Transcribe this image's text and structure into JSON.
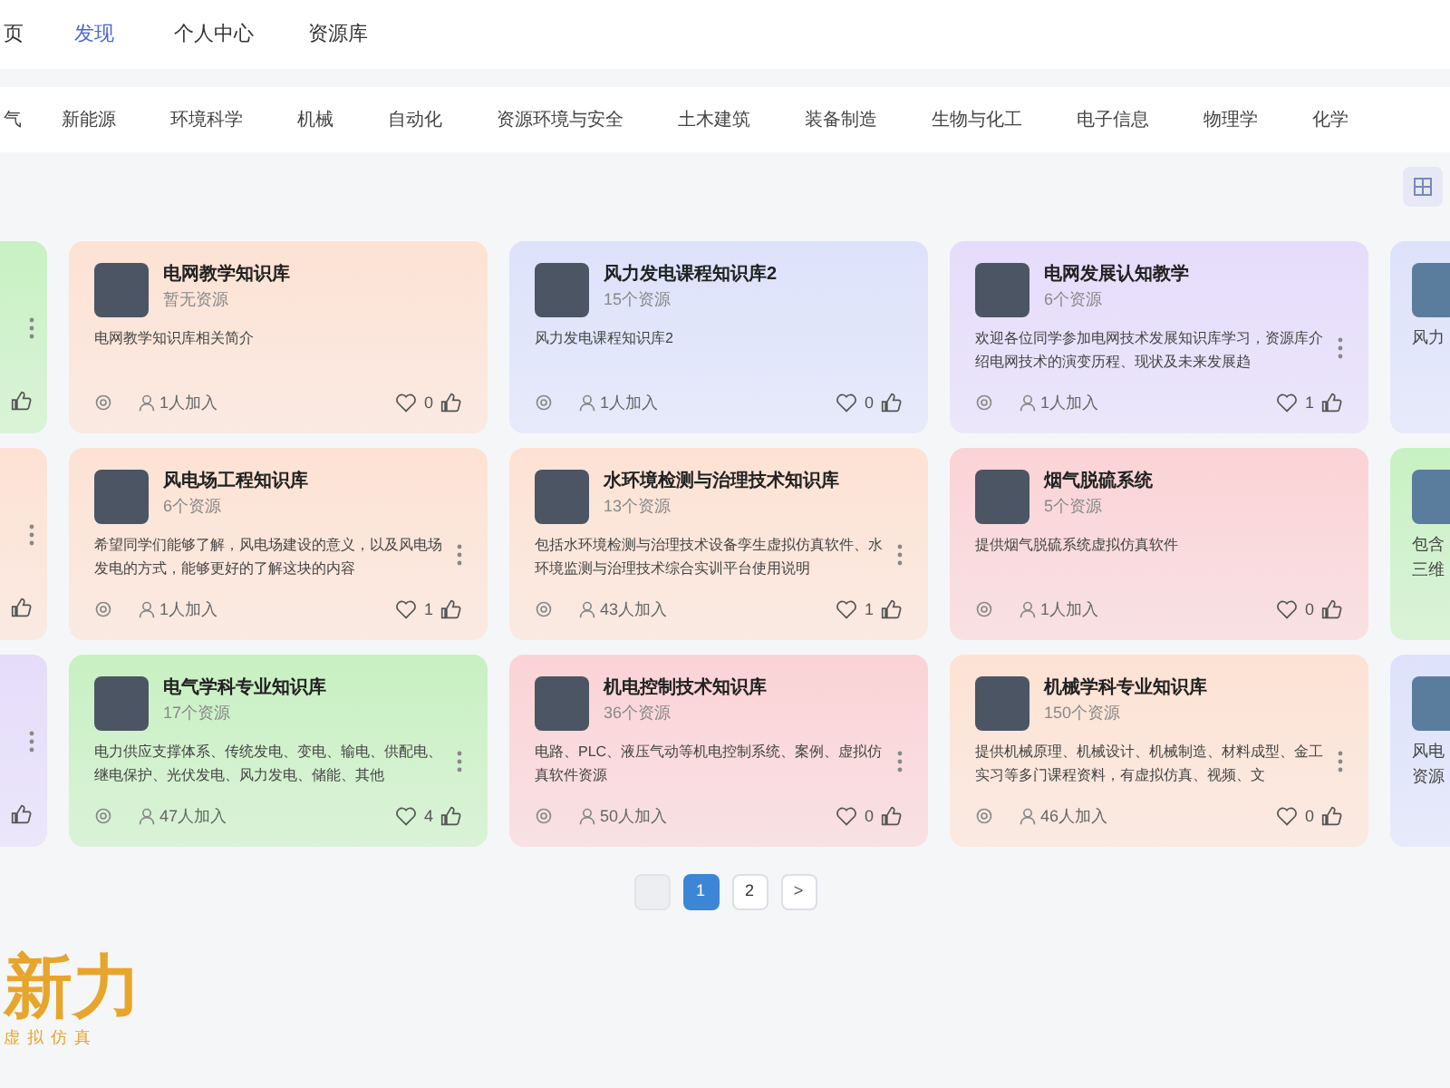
{
  "nav": {
    "items": [
      {
        "label": "页",
        "selected": false
      },
      {
        "label": "发现",
        "selected": true
      },
      {
        "label": "个人中心",
        "selected": false
      },
      {
        "label": "资源库",
        "selected": false
      }
    ]
  },
  "categories": [
    {
      "label": "气"
    },
    {
      "label": "新能源"
    },
    {
      "label": "环境科学"
    },
    {
      "label": "机械"
    },
    {
      "label": "自动化"
    },
    {
      "label": "资源环境与安全"
    },
    {
      "label": "土木建筑"
    },
    {
      "label": "装备制造"
    },
    {
      "label": "生物与化工"
    },
    {
      "label": "电子信息"
    },
    {
      "label": "物理学"
    },
    {
      "label": "化学"
    }
  ],
  "card_rows": [
    {
      "cards": [
        {
          "kind": "edge_left",
          "color": "#c8f1c3",
          "more_menu": true
        },
        {
          "kind": "full",
          "color": "#fde2d4",
          "title": "电网教学知识库",
          "count": "暂无资源",
          "description": "电网教学知识库相关简介",
          "joined": "1人加入",
          "likes": "0",
          "more_menu": false
        },
        {
          "kind": "full",
          "color": "#dde2fb",
          "title": "风力发电课程知识库2",
          "count": "15个资源",
          "description": "风力发电课程知识库2",
          "joined": "1人加入",
          "likes": "0",
          "more_menu": false
        },
        {
          "kind": "full",
          "color": "#e5dcfb",
          "title": "电网发展认知教学",
          "count": "6个资源",
          "description": "欢迎各位同学参加电网技术发展知识库学习，资源库介绍电网技术的演变历程、现状及未来发展趋",
          "joined": "1人加入",
          "likes": "1",
          "more_menu": true
        },
        {
          "kind": "edge_right",
          "color": "#dde2fb",
          "description": "风力"
        }
      ]
    },
    {
      "cards": [
        {
          "kind": "edge_left",
          "color": "#fde2d4",
          "more_menu": true
        },
        {
          "kind": "full",
          "color": "#fde2d4",
          "title": "风电场工程知识库",
          "count": "6个资源",
          "description": "希望同学们能够了解，风电场建设的意义，以及风电场发电的方式，能够更好的了解这块的内容",
          "joined": "1人加入",
          "likes": "1",
          "more_menu": true
        },
        {
          "kind": "full",
          "color": "#fde2d4",
          "title": "水环境检测与治理技术知识库",
          "count": "13个资源",
          "description": "包括水环境检测与治理技术设备孪生虚拟仿真软件、水环境监测与治理技术综合实训平台使用说明",
          "joined": "43人加入",
          "likes": "1",
          "more_menu": true
        },
        {
          "kind": "full",
          "color": "#fbd3d6",
          "title": "烟气脱硫系统",
          "count": "5个资源",
          "description": "提供烟气脱硫系统虚拟仿真软件",
          "joined": "1人加入",
          "likes": "0",
          "more_menu": false
        },
        {
          "kind": "edge_right",
          "color": "#c8f1c3",
          "description": "包含三维"
        }
      ]
    },
    {
      "cards": [
        {
          "kind": "edge_left",
          "color": "#e5dcfb",
          "more_menu": true
        },
        {
          "kind": "full",
          "color": "#c8f0c2",
          "title": "电气学科专业知识库",
          "count": "17个资源",
          "description": "电力供应支撑体系、传统发电、变电、输电、供配电、继电保护、光伏发电、风力发电、储能、其他",
          "joined": "47人加入",
          "likes": "4",
          "more_menu": true
        },
        {
          "kind": "full",
          "color": "#fbd3d6",
          "title": "机电控制技术知识库",
          "count": "36个资源",
          "description": "电路、PLC、液压气动等机电控制系统、案例、虚拟仿真软件资源",
          "joined": "50人加入",
          "likes": "0",
          "more_menu": true
        },
        {
          "kind": "full",
          "color": "#fde2d4",
          "title": "机械学科专业知识库",
          "count": "150个资源",
          "description": "提供机械原理、机械设计、机械制造、材料成型、金工实习等多门课程资料，有虚拟仿真、视频、文",
          "joined": "46人加入",
          "likes": "0",
          "more_menu": true
        },
        {
          "kind": "edge_right",
          "color": "#dde2fb",
          "description": "风电资源"
        }
      ]
    }
  ],
  "pagination": {
    "pages": [
      {
        "label": "1",
        "selected": true
      },
      {
        "label": "2",
        "selected": false
      }
    ],
    "next": ">"
  },
  "footer": {
    "logo": "新力",
    "tagline": "虚拟仿真"
  }
}
